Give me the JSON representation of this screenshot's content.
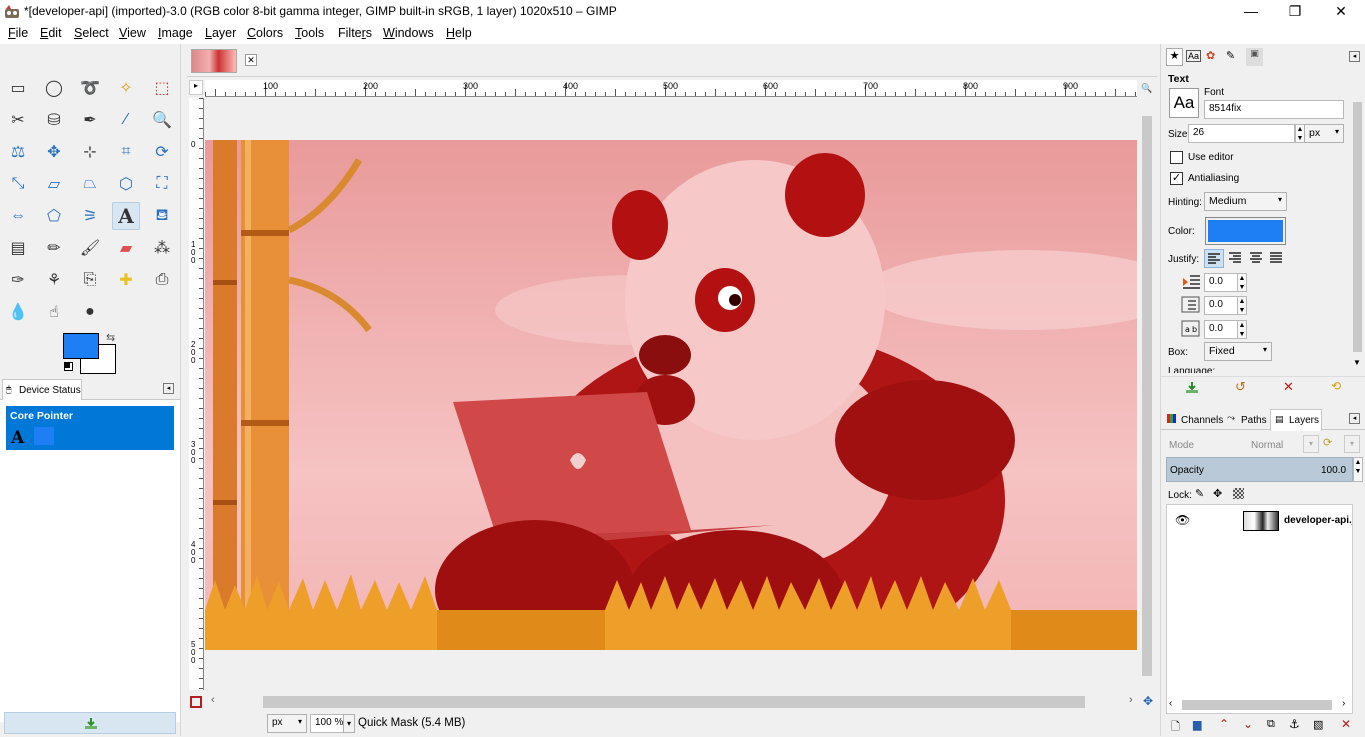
{
  "window": {
    "title": "*[developer-api] (imported)-3.0 (RGB color 8-bit gamma integer, GIMP built-in sRGB, 1 layer) 1020x510 – GIMP",
    "minimize": "—",
    "maximize": "❐",
    "close": "✕"
  },
  "menu": [
    "File",
    "Edit",
    "Select",
    "View",
    "Image",
    "Layer",
    "Colors",
    "Tools",
    "Filters",
    "Windows",
    "Help"
  ],
  "menu_accel": [
    "F",
    "E",
    "S",
    "V",
    "I",
    "L",
    "C",
    "T",
    "r",
    "W",
    "H"
  ],
  "toolbox": {
    "tools": [
      "rect-select",
      "ellipse-select",
      "free-select",
      "fuzzy-select",
      "select-by-color",
      "scissors",
      "foreground-select",
      "paths",
      "color-picker",
      "zoom",
      "measure",
      "move",
      "alignment",
      "crop",
      "rotate",
      "scale",
      "shear",
      "perspective",
      "unified-transform",
      "handle-transform",
      "flip",
      "cage",
      "warp",
      "text",
      "bucket-fill",
      "gradient",
      "pencil",
      "paintbrush",
      "eraser",
      "airbrush",
      "ink",
      "mypaint-brush",
      "clone",
      "heal",
      "perspective-clone",
      "blur-sharpen",
      "smudge",
      "dodge-burn"
    ],
    "active_tool": "text",
    "fg_color": "#1e7ff5",
    "bg_color": "#ffffff",
    "device_status": {
      "tab": "Device Status",
      "core_pointer": "Core Pointer",
      "tool_glyph": "A"
    }
  },
  "canvas": {
    "ruler_top": [
      "100",
      "200",
      "300",
      "400",
      "500",
      "600",
      "700",
      "800",
      "900"
    ],
    "ruler_left": [
      "0",
      "1\n0\n0",
      "2\n0\n0",
      "3\n0\n0",
      "4\n0\n0",
      "5\n0\n0"
    ],
    "status": {
      "unit": "px",
      "zoom": "100 %",
      "message": "Quick Mask (5.4 MB)"
    }
  },
  "tool_options": {
    "section": "Text",
    "font_label": "Font",
    "font_preview": "Aa",
    "font_value": "8514fix",
    "size_label": "Size:",
    "size_value": "26",
    "size_unit": "px",
    "use_editor": "Use editor",
    "use_editor_checked": false,
    "antialiasing": "Antialiasing",
    "antialiasing_checked": true,
    "hinting_label": "Hinting:",
    "hinting_value": "Medium",
    "color_label": "Color:",
    "color_value": "#1e7ff5",
    "justify_label": "Justify:",
    "indent_value": "0.0",
    "line_spacing_value": "0.0",
    "letter_spacing_value": "0.0",
    "box_label": "Box:",
    "box_value": "Fixed",
    "language_label": "Language:"
  },
  "layers_panel": {
    "tabs": [
      "Channels",
      "Paths",
      "Layers"
    ],
    "mode_label": "Mode",
    "mode_value": "Normal",
    "opacity_label": "Opacity",
    "opacity_value": "100.0",
    "lock_label": "Lock:",
    "layers": [
      {
        "name": "developer-api.jpg",
        "visible": true
      }
    ]
  }
}
